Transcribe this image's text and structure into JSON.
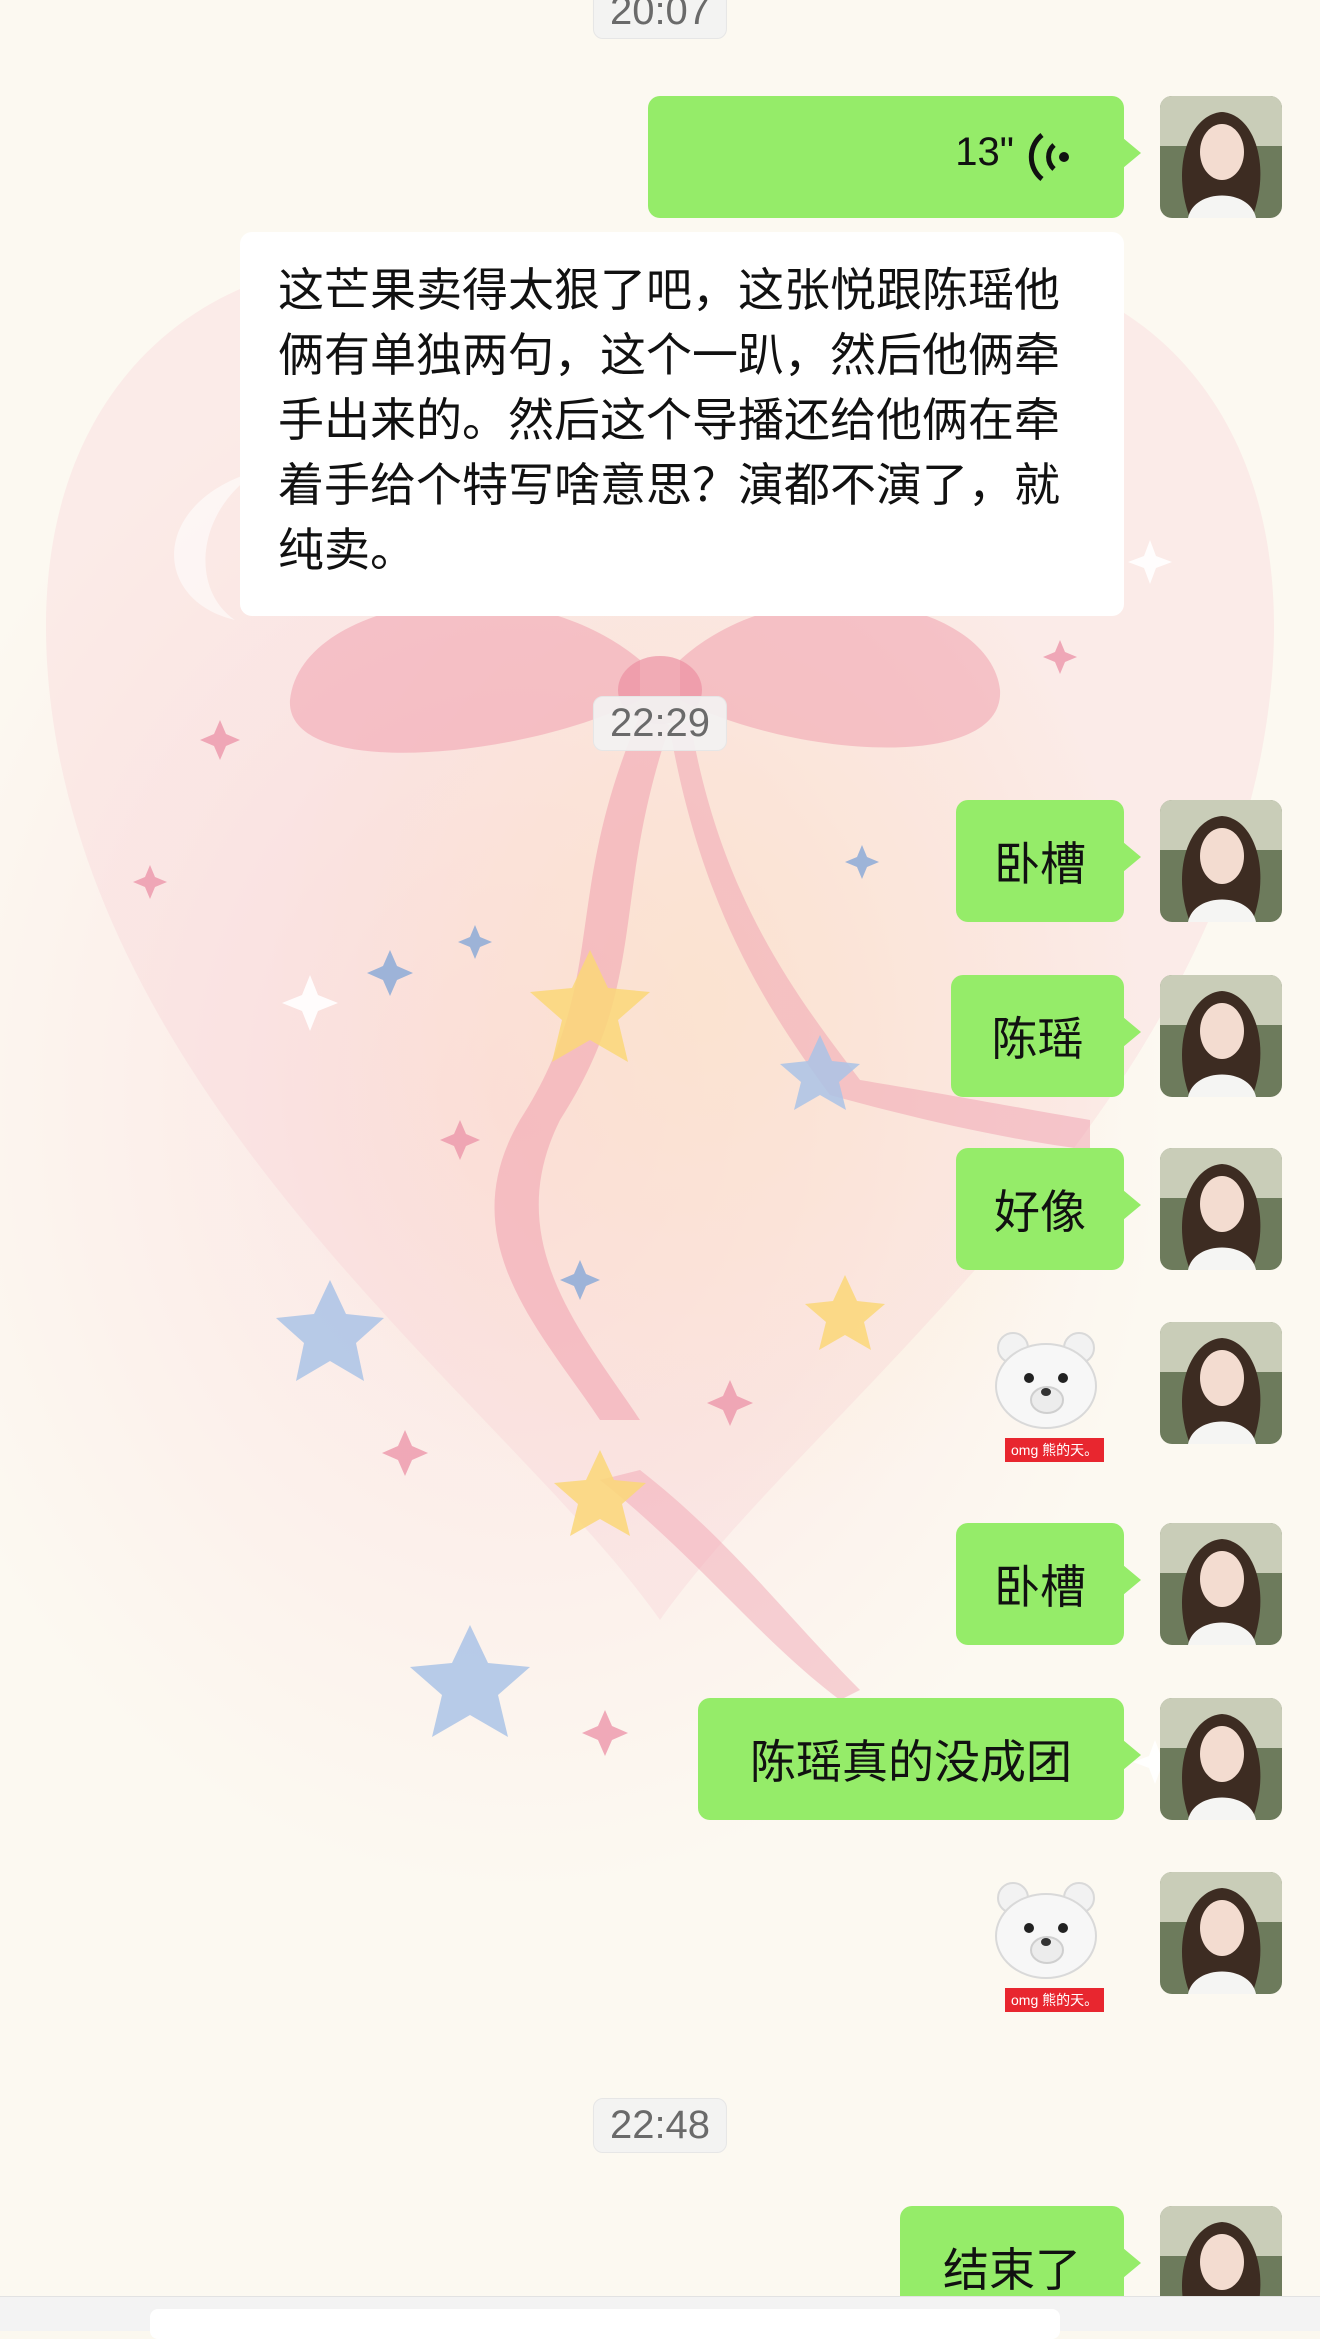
{
  "timestamps": [
    "20:07",
    "22:29",
    "22:48"
  ],
  "voice_message": {
    "duration": "13\"",
    "icon": "voice-wave-icon"
  },
  "received_message": "这芒果卖得太狠了吧，这张悦跟陈瑶他俩有单独两句，这个一趴，然后他俩牵手出来的。然后这个导播还给他俩在牵着手给个特写啥意思？演都不演了，就纯卖。",
  "sent_messages": [
    "卧槽",
    "陈瑶",
    "好像",
    "卧槽",
    "陈瑶真的没成团",
    "结束了"
  ],
  "sticker": {
    "caption": "omg 熊的天。",
    "icon": "bear-covering-mouth-sticker"
  },
  "colors": {
    "sent_bubble": "#95ec69",
    "received_bubble": "#ffffff",
    "timestamp_bg": "#f2f2f2"
  }
}
